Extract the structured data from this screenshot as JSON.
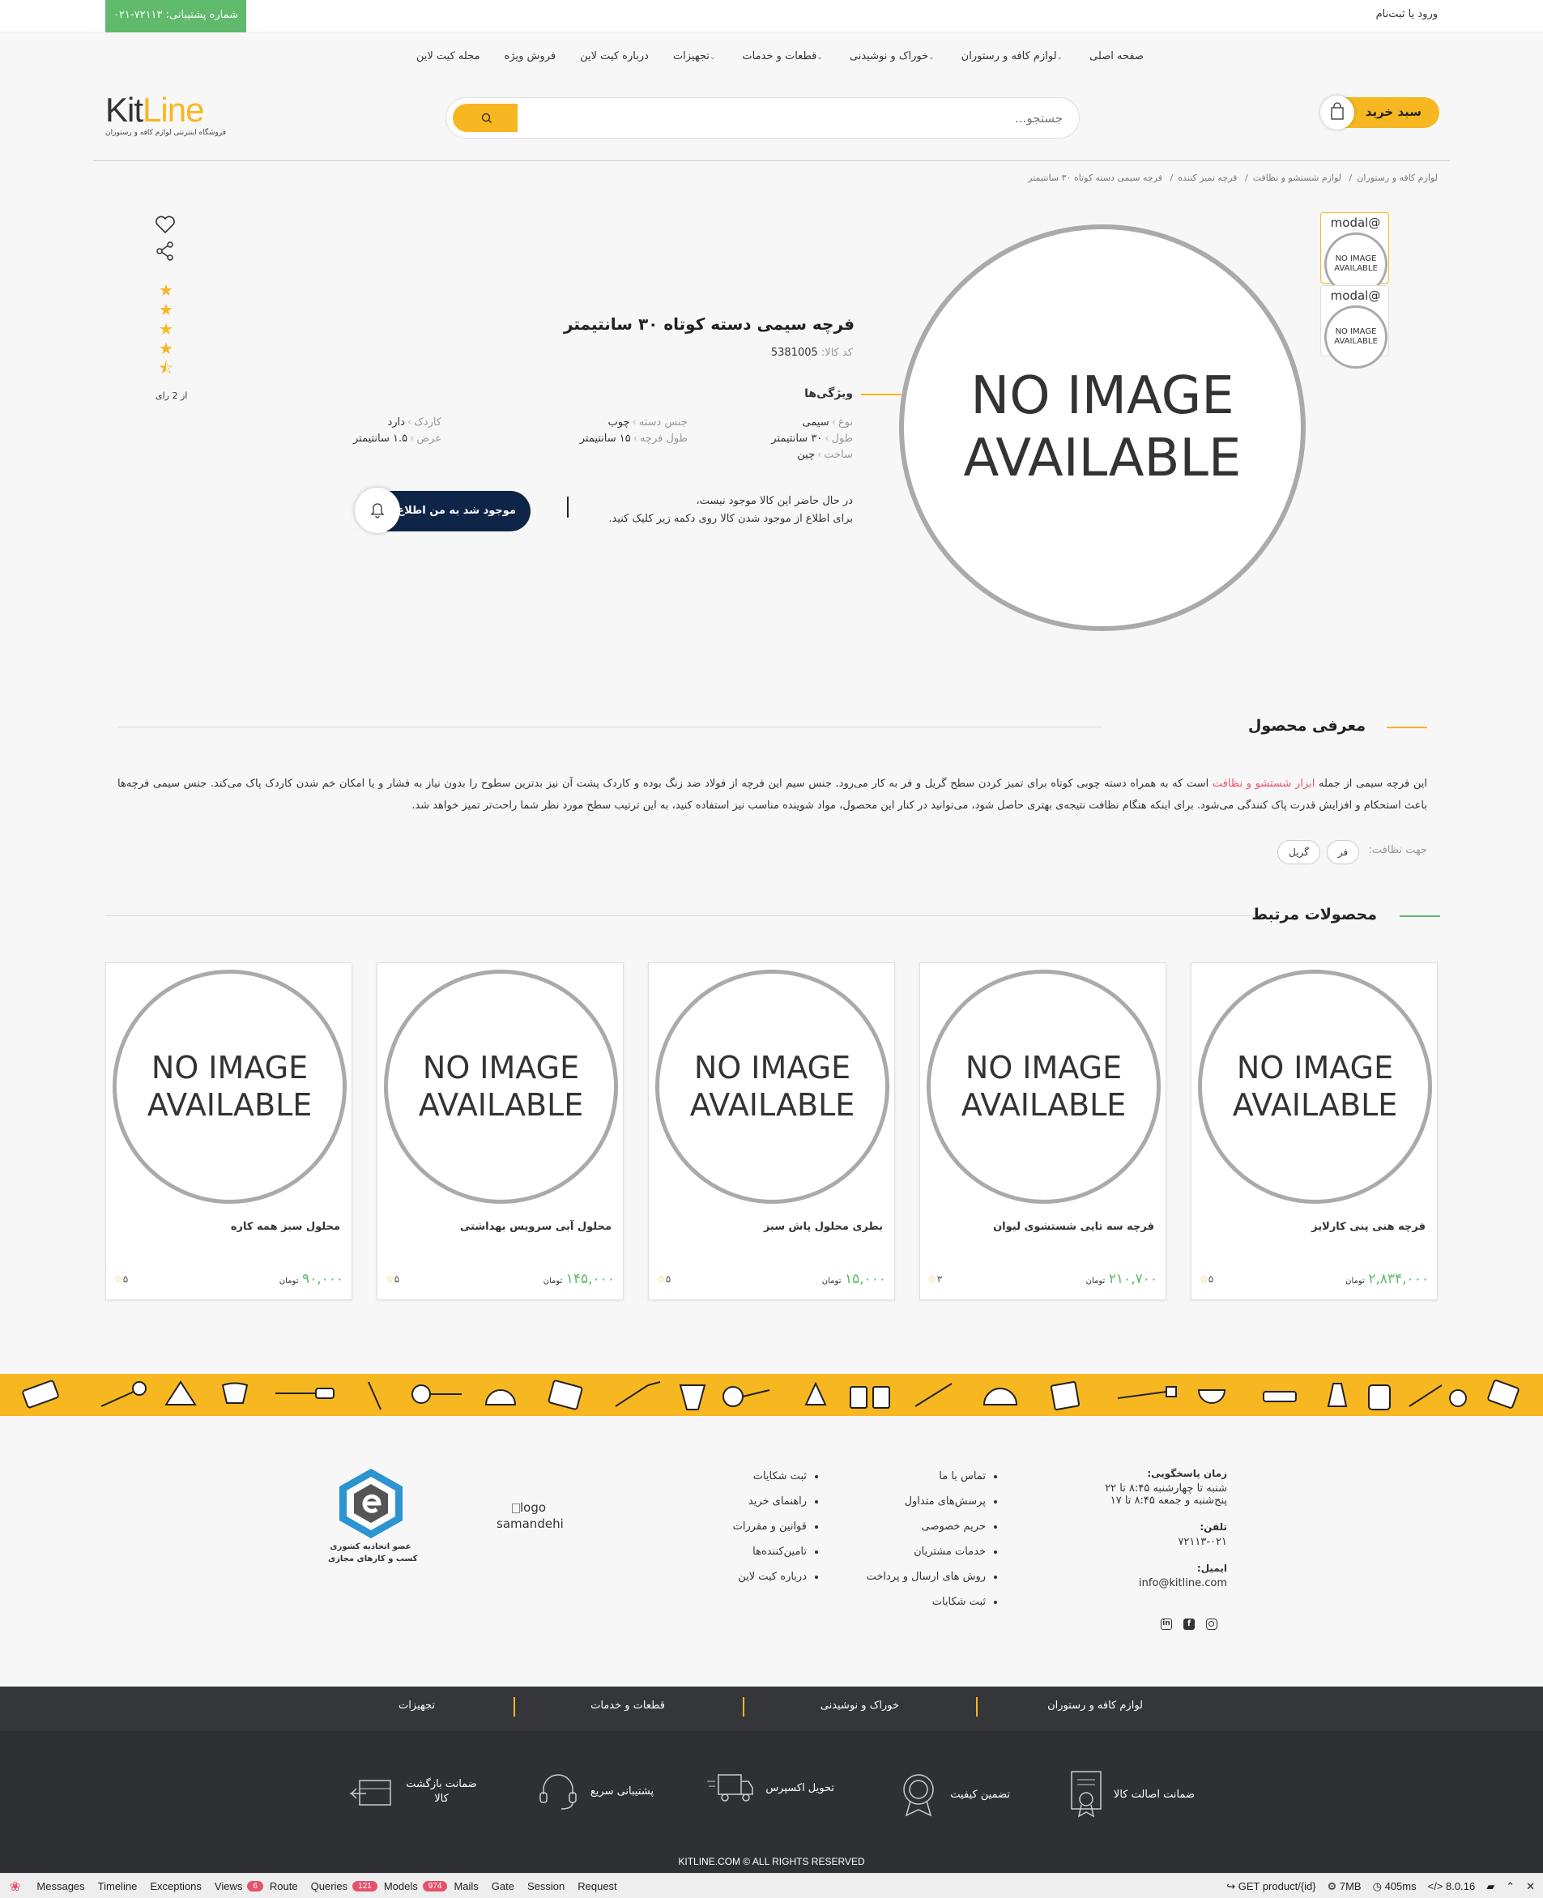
{
  "topbar": {
    "support_label": "شماره پشتیبانی: ۷۲۱۱۳-۰۲۱",
    "login_label": "ورود یا ثبت‌نام"
  },
  "nav": [
    {
      "label": "صفحه اصلی",
      "dropdown": false
    },
    {
      "label": "لوازم کافه و رستوران",
      "dropdown": true
    },
    {
      "label": "خوراک و نوشیدنی",
      "dropdown": true
    },
    {
      "label": "قطعات و خدمات",
      "dropdown": true
    },
    {
      "label": "تجهیزات",
      "dropdown": true
    },
    {
      "label": "درباره کیت لاین",
      "dropdown": false
    },
    {
      "label": "فروش ویژه",
      "dropdown": false
    },
    {
      "label": "مجله کیت لاین",
      "dropdown": false
    }
  ],
  "logo": {
    "text_a": "Kit",
    "text_b": "Line",
    "tagline": "فروشگاه اینترنتی لوازم کافه و رستوران"
  },
  "search": {
    "placeholder": "جستجو..."
  },
  "cart": {
    "label": "سبد خرید"
  },
  "breadcrumb": [
    "لوازم کافه و رستوران",
    "لوازم شستشو و نظافت",
    "فرچه تمیز کننده",
    "فرچه سیمی دسته کوتاه ۳۰ سانتیمتر"
  ],
  "gallery": {
    "no_image_line1": "NO IMAGE",
    "no_image_line2": "AVAILABLE",
    "thumb_label": "modal@",
    "thumb_count": 2
  },
  "product": {
    "title": "فرچه سیمی دسته کوتاه ۳۰ سانتیمتر",
    "code_label": "کد کالا:",
    "code_value": "5381005",
    "features_title": "ویژگی‌ها",
    "features": [
      {
        "key": "نوع",
        "value": "سیمی"
      },
      {
        "key": "جنس دسته",
        "value": "چوب"
      },
      {
        "key": "کاردک",
        "value": "دارد"
      },
      {
        "key": "طول",
        "value": "۳۰ سانتیمتر"
      },
      {
        "key": "طول فرچه",
        "value": "۱۵ سانتیمتر"
      },
      {
        "key": "عرض",
        "value": "۱.۵ سانتیمتر"
      },
      {
        "key": "ساخت",
        "value": "چین"
      }
    ],
    "availability_line1": "در حال حاضر این کالا موجود نیست،",
    "availability_line2": "برای اطلاع از موجود شدن کالا روی دکمه زیر کلیک کنید.",
    "notify_label": "موجود شد به من اطلاع بده",
    "rating": 4.5,
    "rating_count_label": "از 2 رای"
  },
  "intro": {
    "title": "معرفی محصول",
    "text_before": "این فرچه سیمی از جمله ",
    "link": "ابزار شستشو و نظافت",
    "text_after": " است که به همراه دسته چوبی کوتاه برای تمیز کردن سطح گریل و فر به کار می‌رود. جنس سیم این فرچه از فولاد ضد زنگ بوده و کاردک پشت آن نیز بدترین سطوح را بدون نیاز به فشار و یا امکان خم شدن کاردک پاک می‌کند. جنس سیمی فرچه‌ها باعث استحکام و افزایش قدرت پاک کنندگی می‌شود. برای اینکه هنگام نظافت نتیجه‌ی بهتری حاصل شود، می‌توانید در کنار این محصول، مواد شوینده مناسب نیز استفاده کنید، به این ترتیب سطح مورد نظر شما راحت‌تر تمیز خواهد شد.",
    "tags_label": "جهت نظافت:",
    "tags": [
      "فر",
      "گریل"
    ]
  },
  "related": {
    "title": "محصولات مرتبط",
    "currency": "تومان",
    "items": [
      {
        "name": "فرچه هنی پنی کارلایز",
        "price": "۲,۸۳۴,۰۰۰",
        "rating": "۵"
      },
      {
        "name": "فرچه سه تایی شستشوی لیوان",
        "price": "۲۱۰,۷۰۰",
        "rating": "۳"
      },
      {
        "name": "بطری محلول پاش سبز",
        "price": "۱۵,۰۰۰",
        "rating": "۵"
      },
      {
        "name": "محلول آبی سرویس بهداشتی",
        "price": "۱۴۵,۰۰۰",
        "rating": "۵"
      },
      {
        "name": "محلول سبز همه کاره",
        "price": "۹۰,۰۰۰",
        "rating": "۵"
      }
    ]
  },
  "footer": {
    "hours_label": "زمان پاسخگویی:",
    "hours_line1": "شنبه تا چهارشنبه ۸:۴۵ تا ۲۲",
    "hours_line2": "پنج‌شنبه و جمعه ۸:۴۵ تا ۱۷",
    "phone_label": "تلفن:",
    "phone": "۷۲۱۱۳-۰۲۱",
    "email_label": "ایمیل:",
    "email": "info@kitline.com",
    "links_col1": [
      "تماس با ما",
      "پرسش‌های متداول",
      "حریم خصوصی",
      "خدمات مشتریان",
      "روش های ارسال و پرداخت",
      "ثبت شکایات"
    ],
    "links_col2": [
      "ثبت شکایات",
      "راهنمای خرید",
      "قوانین و مقررات",
      "تامین‌کننده‌ها",
      "درباره کیت لاین"
    ],
    "samandehi_alt": "logo",
    "samandehi_text": "samandehi",
    "union_line1": "عضو اتحادیه کشوری",
    "union_line2": "کسب و کارهای مجازی"
  },
  "footer_cats": [
    "لوازم کافه و رستوران",
    "خوراک و نوشیدنی",
    "قطعات و خدمات",
    "تجهیزات"
  ],
  "guarantees": [
    "ضمانت اصالت کالا",
    "تضمین کیفیت",
    "تحویل اکسپرس",
    "پشتیبانی سریع",
    "ضمانت بازگشت کالا"
  ],
  "copyright": "KITLINE.COM © ALL RIGHTS RESERVED",
  "debugbar": {
    "tabs": [
      "Messages",
      "Timeline",
      "Exceptions",
      "Views",
      "Route",
      "Queries",
      "Models",
      "Mails",
      "Gate",
      "Session",
      "Request"
    ],
    "views_badge": "6",
    "queries_badge": "121",
    "models_badge": "974",
    "route": "GET product/{id}",
    "memory": "7MB",
    "time": "405ms",
    "version": "8.0.16"
  },
  "colors": {
    "accent": "#f7b721",
    "green": "#5fba6b",
    "navy": "#0f2547",
    "dark": "#2f3034",
    "link": "#e5536b"
  }
}
